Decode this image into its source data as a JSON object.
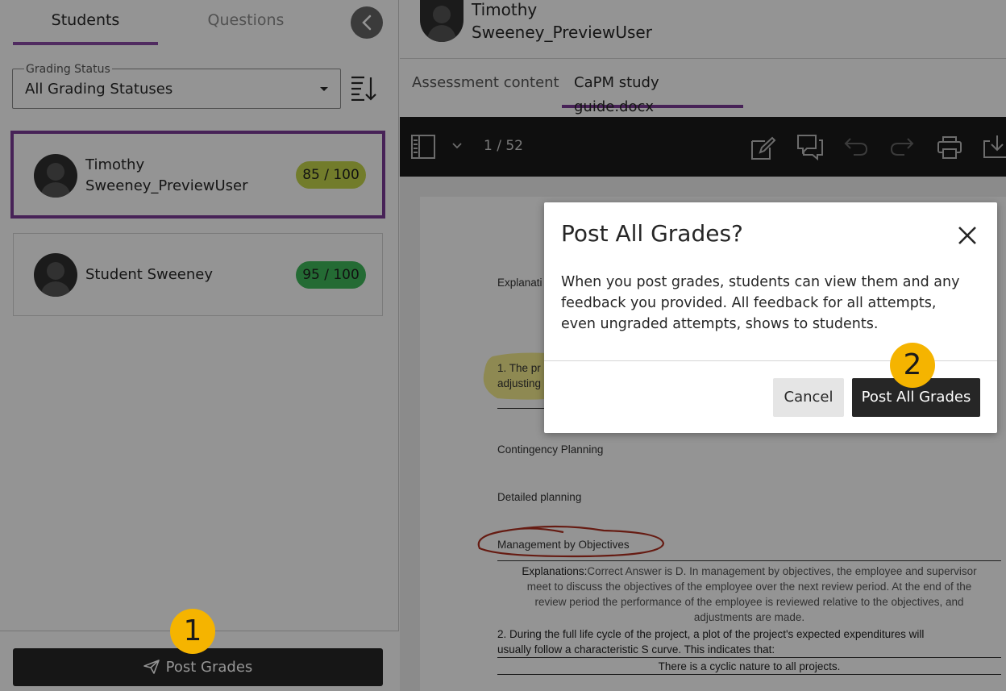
{
  "left_panel": {
    "tabs": [
      {
        "label": "Students"
      },
      {
        "label": "Questions"
      }
    ],
    "grading_status": {
      "label": "Grading Status",
      "value": "All Grading Statuses"
    },
    "students": [
      {
        "first": "Timothy",
        "last": "Sweeney_PreviewUser",
        "grade": "85 / 100",
        "badge_color": "#c4d64a"
      },
      {
        "name": "Student Sweeney",
        "grade": "95 / 100",
        "badge_color": "#3fb85a"
      }
    ],
    "post_grades_label": "Post Grades"
  },
  "right_panel": {
    "student_first": "Timothy",
    "student_last": "Sweeney_PreviewUser",
    "tabs": [
      {
        "label": "Assessment content"
      },
      {
        "label": "CaPM study guide.docx"
      }
    ],
    "page_indicator": "1 / 52",
    "document": {
      "explanation_prefix": "Explanati",
      "q1_fragment_a": "1. The pr",
      "q1_fragment_b": "adjusting",
      "option_contingency": "Contingency Planning",
      "option_detailed": "Detailed planning",
      "option_mbo": "Management by Objectives",
      "explanation_label": "Explanations:",
      "explanation_text_1": "Correct Answer is D. In management by objectives, the employee and supervisor",
      "explanation_text_2": "meet to discuss the objectives of the employee over the next review period. At the end of the",
      "explanation_text_3": "review period the performance of the employee is reviewed relative to the objectives, and",
      "explanation_text_4": "adjustments are made.",
      "q2_line_1": "2. During the full life cycle of the project, a plot of the project's expected expenditures will",
      "q2_line_2": "usually follow a characteristic S curve. This indicates that:",
      "q2_answer": "There is a cyclic nature to all projects."
    }
  },
  "modal": {
    "title": "Post All Grades?",
    "body": "When you post grades, students can view them and any feedback you provided. All feedback for all attempts, even ungraded attempts, shows to students.",
    "cancel_label": "Cancel",
    "confirm_label": "Post All Grades"
  },
  "callouts": {
    "step_1": "1",
    "step_2": "2"
  },
  "colors": {
    "accent_purple": "#7a3c96",
    "callout_yellow": "#f5b400",
    "annotation_red": "#b03020",
    "highlight_yellow": "#f2ea7a"
  },
  "icons": [
    "chevron-left-icon",
    "sort-icon",
    "paper-plane-icon",
    "sidebar-toggle-icon",
    "chevron-down-icon",
    "annotate-icon",
    "comment-icon",
    "undo-icon",
    "redo-icon",
    "print-icon",
    "download-icon",
    "close-icon"
  ]
}
